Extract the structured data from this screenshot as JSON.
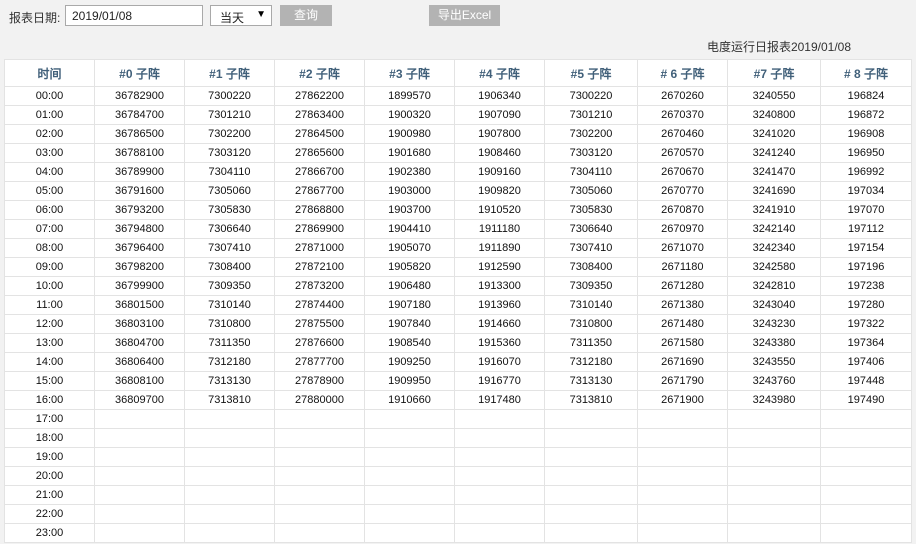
{
  "toolbar": {
    "date_label": "报表日期:",
    "date_value": "2019/01/08",
    "range_selected": "当天",
    "query_button": "查询",
    "export_button": "导出Excel"
  },
  "report": {
    "title": "电度运行日报表2019/01/08"
  },
  "table": {
    "headers": [
      "时间",
      "#0 子阵",
      "#1 子阵",
      "#2 子阵",
      "#3 子阵",
      "#4 子阵",
      "#5 子阵",
      "# 6 子阵",
      "#7 子阵",
      "# 8 子阵"
    ],
    "rows": [
      [
        "00:00",
        "36782900",
        "7300220",
        "27862200",
        "1899570",
        "1906340",
        "7300220",
        "2670260",
        "3240550",
        "196824"
      ],
      [
        "01:00",
        "36784700",
        "7301210",
        "27863400",
        "1900320",
        "1907090",
        "7301210",
        "2670370",
        "3240800",
        "196872"
      ],
      [
        "02:00",
        "36786500",
        "7302200",
        "27864500",
        "1900980",
        "1907800",
        "7302200",
        "2670460",
        "3241020",
        "196908"
      ],
      [
        "03:00",
        "36788100",
        "7303120",
        "27865600",
        "1901680",
        "1908460",
        "7303120",
        "2670570",
        "3241240",
        "196950"
      ],
      [
        "04:00",
        "36789900",
        "7304110",
        "27866700",
        "1902380",
        "1909160",
        "7304110",
        "2670670",
        "3241470",
        "196992"
      ],
      [
        "05:00",
        "36791600",
        "7305060",
        "27867700",
        "1903000",
        "1909820",
        "7305060",
        "2670770",
        "3241690",
        "197034"
      ],
      [
        "06:00",
        "36793200",
        "7305830",
        "27868800",
        "1903700",
        "1910520",
        "7305830",
        "2670870",
        "3241910",
        "197070"
      ],
      [
        "07:00",
        "36794800",
        "7306640",
        "27869900",
        "1904410",
        "1911180",
        "7306640",
        "2670970",
        "3242140",
        "197112"
      ],
      [
        "08:00",
        "36796400",
        "7307410",
        "27871000",
        "1905070",
        "1911890",
        "7307410",
        "2671070",
        "3242340",
        "197154"
      ],
      [
        "09:00",
        "36798200",
        "7308400",
        "27872100",
        "1905820",
        "1912590",
        "7308400",
        "2671180",
        "3242580",
        "197196"
      ],
      [
        "10:00",
        "36799900",
        "7309350",
        "27873200",
        "1906480",
        "1913300",
        "7309350",
        "2671280",
        "3242810",
        "197238"
      ],
      [
        "11:00",
        "36801500",
        "7310140",
        "27874400",
        "1907180",
        "1913960",
        "7310140",
        "2671380",
        "3243040",
        "197280"
      ],
      [
        "12:00",
        "36803100",
        "7310800",
        "27875500",
        "1907840",
        "1914660",
        "7310800",
        "2671480",
        "3243230",
        "197322"
      ],
      [
        "13:00",
        "36804700",
        "7311350",
        "27876600",
        "1908540",
        "1915360",
        "7311350",
        "2671580",
        "3243380",
        "197364"
      ],
      [
        "14:00",
        "36806400",
        "7312180",
        "27877700",
        "1909250",
        "1916070",
        "7312180",
        "2671690",
        "3243550",
        "197406"
      ],
      [
        "15:00",
        "36808100",
        "7313130",
        "27878900",
        "1909950",
        "1916770",
        "7313130",
        "2671790",
        "3243760",
        "197448"
      ],
      [
        "16:00",
        "36809700",
        "7313810",
        "27880000",
        "1910660",
        "1917480",
        "7313810",
        "2671900",
        "3243980",
        "197490"
      ],
      [
        "17:00",
        "",
        "",
        "",
        "",
        "",
        "",
        "",
        "",
        ""
      ],
      [
        "18:00",
        "",
        "",
        "",
        "",
        "",
        "",
        "",
        "",
        ""
      ],
      [
        "19:00",
        "",
        "",
        "",
        "",
        "",
        "",
        "",
        "",
        ""
      ],
      [
        "20:00",
        "",
        "",
        "",
        "",
        "",
        "",
        "",
        "",
        ""
      ],
      [
        "21:00",
        "",
        "",
        "",
        "",
        "",
        "",
        "",
        "",
        ""
      ],
      [
        "22:00",
        "",
        "",
        "",
        "",
        "",
        "",
        "",
        "",
        ""
      ],
      [
        "23:00",
        "",
        "",
        "",
        "",
        "",
        "",
        "",
        "",
        ""
      ]
    ]
  }
}
